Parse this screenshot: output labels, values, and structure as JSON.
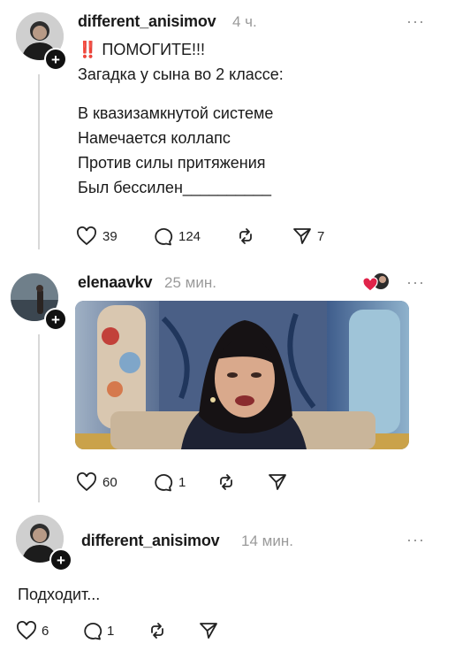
{
  "post1": {
    "username": "different_anisimov",
    "time": "4 ч.",
    "lines": [
      "‼️ ПОМОГИТЕ!!!",
      "Загадка у сына во 2 классе:",
      "В квазизамкнутой системе",
      "Намечается коллапс",
      "Против силы притяжения",
      "Был бессилен__________"
    ],
    "likes": "39",
    "comments": "124",
    "shares": "7",
    "more": "···"
  },
  "post2": {
    "username": "elenaavkv",
    "time": "25 мин.",
    "likes": "60",
    "comments": "1",
    "more": "···"
  },
  "post3": {
    "username": "different_anisimov",
    "time": "14 мин.",
    "text": "Подходит...",
    "likes": "6",
    "comments": "1",
    "more": "···"
  },
  "icons": {
    "follow": "+",
    "heart": "heart-icon",
    "comment": "comment-icon",
    "repost": "repost-icon",
    "share": "send-icon"
  },
  "colors": {
    "text": "#1a1a1a",
    "muted": "#9a9a9a",
    "heart_badge": "#e0244a"
  }
}
